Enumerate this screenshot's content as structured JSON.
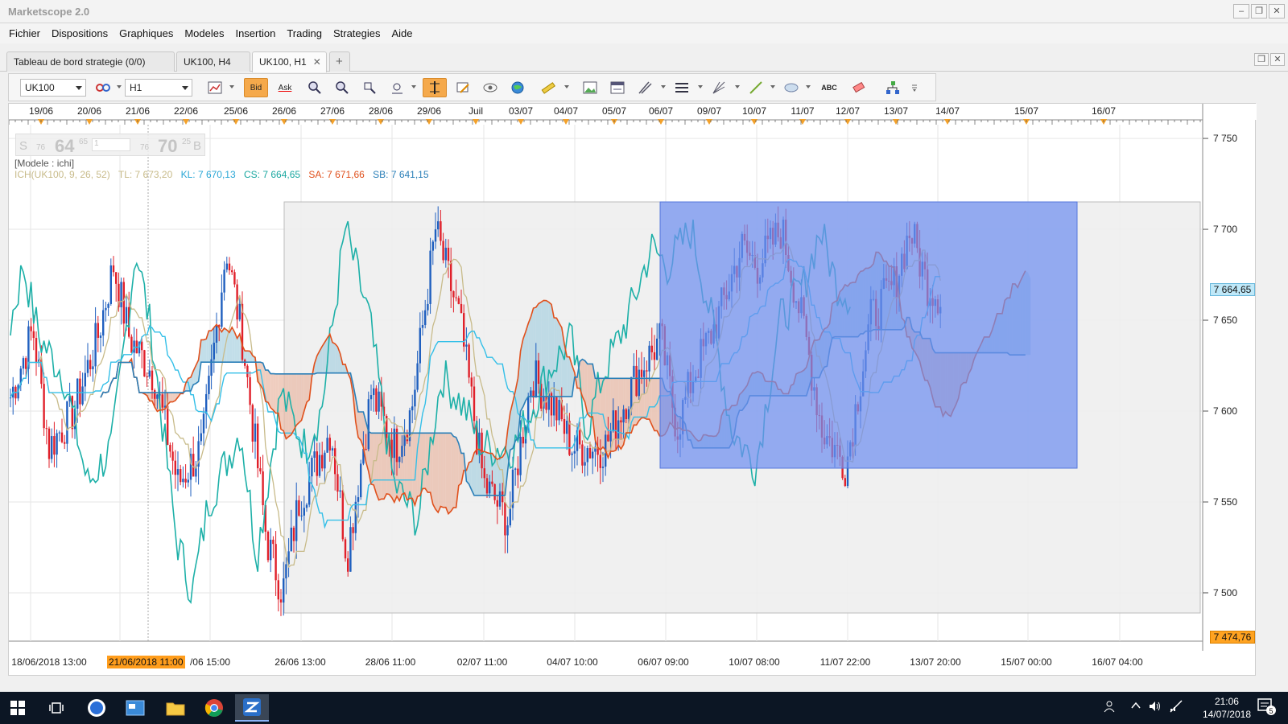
{
  "app": {
    "title": "Marketscope 2.0"
  },
  "window_buttons": {
    "minimize": "–",
    "restore": "❐",
    "close": "✕"
  },
  "menu": [
    "Fichier",
    "Dispositions",
    "Graphiques",
    "Modeles",
    "Insertion",
    "Trading",
    "Strategies",
    "Aide"
  ],
  "tabs": [
    {
      "label": "Tableau de bord strategie (0/0)",
      "active": false,
      "closable": false
    },
    {
      "label": "UK100, H4",
      "active": false,
      "closable": false
    },
    {
      "label": "UK100, H1",
      "active": true,
      "closable": true
    }
  ],
  "tab_add": "+",
  "toolbar": {
    "instrument": "UK100",
    "timeframe": "H1",
    "bid_label": "Bid",
    "ask_label": "Ask",
    "abc_label": "ABC"
  },
  "chart": {
    "date_labels": [
      "19/06",
      "20/06",
      "21/06",
      "22/06",
      "25/06",
      "26/06",
      "27/06",
      "28/06",
      "29/06",
      "Juil",
      "03/07",
      "04/07",
      "05/07",
      "06/07",
      "09/07",
      "10/07",
      "11/07",
      "12/07",
      "13/07",
      "14/07",
      "15/07",
      "16/07"
    ],
    "time_labels": [
      "18/06/2018 13:00",
      "21/06/2018 11:00",
      "/06 15:00",
      "26/06 13:00",
      "28/06 11:00",
      "02/07 11:00",
      "04/07 10:00",
      "06/07 09:00",
      "10/07 08:00",
      "11/07 22:00",
      "13/07 20:00",
      "15/07 00:00",
      "16/07 04:00"
    ],
    "selected_time": "21/06/2018 11:00",
    "price_labels": [
      "7 750",
      "7 700",
      "7 650",
      "7 600",
      "7 550",
      "7 500"
    ],
    "price_range": [
      7474.76,
      7758
    ],
    "current_price": "7 664,65",
    "low_price": "7 474,76",
    "quote": {
      "sell_label": "S",
      "sell_small": "76",
      "sell_price": "64",
      "sell_sup": "65",
      "lot": "1",
      "buy_small": "76",
      "buy_price": "70",
      "buy_sup": "25",
      "buy_label": "B"
    },
    "model_label": "[Modele : ichi]",
    "legend": [
      {
        "text": "ICH(UK100, 9, 26, 52)",
        "color": "#c8bb8a"
      },
      {
        "text": "TL: 7 673,20",
        "color": "#c8bb8a"
      },
      {
        "text": "KL: 7 670,13",
        "color": "#2aa7d6"
      },
      {
        "text": "CS: 7 664,65",
        "color": "#1aa7a0"
      },
      {
        "text": "SA: 7 671,66",
        "color": "#e0501c"
      },
      {
        "text": "SB: 7 641,15",
        "color": "#2a7fb8"
      }
    ],
    "colors": {
      "bull": "#1f5fbf",
      "bear": "#e0202a",
      "tenkan": "#c8bb8a",
      "kijun": "#33bfe8",
      "chikou": "#1db0a8",
      "senkou_a": "#e0501c",
      "senkou_b": "#2a7fb8",
      "cloud_bear": "#e8b8a4",
      "cloud_bull": "#a8d0e0",
      "grey_box": "#eeeeee",
      "blue_box": "#6f8ff0"
    }
  },
  "taskbar": {
    "time": "21:06",
    "date": "14/07/2018",
    "notifications": "5"
  }
}
